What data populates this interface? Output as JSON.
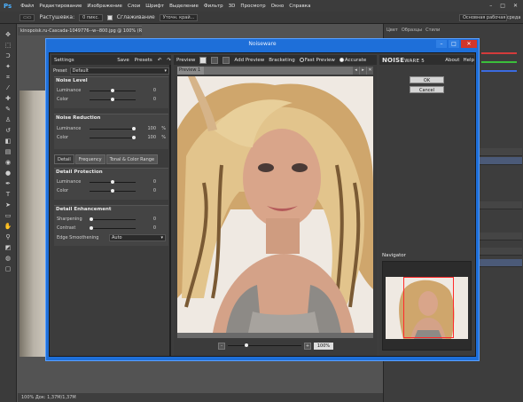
{
  "ps": {
    "logo": "Ps",
    "menu": [
      "Файл",
      "Редактирование",
      "Изображение",
      "Слои",
      "Шрифт",
      "Выделение",
      "Фильтр",
      "3D",
      "Просмотр",
      "Окно",
      "Справка"
    ],
    "window_controls": [
      "–",
      "□",
      "✕"
    ]
  },
  "optbar": {
    "feather_label": "Растушевка:",
    "feather_value": "0 пикс.",
    "antialias_label": "Сглаживание",
    "refine": "Уточн. край...",
    "workspace": "Основная рабочая среда"
  },
  "doc_tab": "kinopoisk.ru-Cascada-1049776--w--800.jpg @ 100% (RGB/8#)",
  "status": "100%        Док: 1,37M/1,37M",
  "right_panel": {
    "tabs": [
      "Цвет",
      "Образцы",
      "Стили"
    ],
    "colors": [
      "#d33b3b",
      "#3bbf3b",
      "#3b6be0"
    ]
  },
  "noiseware": {
    "title": "Noiseware",
    "window_buttons": [
      "–",
      "□",
      "✕"
    ],
    "settings": {
      "header": "Settings",
      "save": "Save",
      "presets": "Presets",
      "preset_label": "Preset",
      "preset_value": "Default",
      "noise_level": {
        "title": "Noise Level",
        "rows": [
          {
            "label": "Luminance",
            "value": "0",
            "pos": 0.5
          },
          {
            "label": "Color",
            "value": "0",
            "pos": 0.5
          }
        ]
      },
      "noise_reduction": {
        "title": "Noise Reduction",
        "rows": [
          {
            "label": "Luminance",
            "value": "100",
            "unit": "%",
            "pos": 1.0
          },
          {
            "label": "Color",
            "value": "100",
            "unit": "%",
            "pos": 1.0
          }
        ]
      },
      "tabs": [
        "Detail",
        "Frequency",
        "Tonal & Color Range"
      ],
      "detail_protection": {
        "title": "Detail Protection",
        "rows": [
          {
            "label": "Luminance",
            "value": "0",
            "pos": 0.5
          },
          {
            "label": "Color",
            "value": "0",
            "pos": 0.5
          }
        ]
      },
      "detail_enhancement": {
        "title": "Detail Enhancement",
        "rows": [
          {
            "label": "Sharpening",
            "value": "0",
            "pos": 0
          },
          {
            "label": "Contrast",
            "value": "0",
            "pos": 0
          }
        ],
        "edge_label": "Edge Smoothening",
        "edge_value": "Auto"
      }
    },
    "preview": {
      "header": "Preview",
      "add_preview": "Add Preview",
      "bracketing": "Bracketing",
      "fast_preview": "Fast Preview",
      "accurate": "Accurate",
      "tab": "Preview 1",
      "arrows": [
        "◂",
        "▸",
        "✕"
      ],
      "zoom_minus": "-",
      "zoom_plus": "+",
      "zoom_value": "100%",
      "zoom_level": 0.24
    },
    "right": {
      "logo_a": "NOISE",
      "logo_b": "WARE 5",
      "about": "About",
      "help": "Help",
      "ok": "OK",
      "cancel": "Cancel",
      "navigator": "Navigator"
    }
  }
}
